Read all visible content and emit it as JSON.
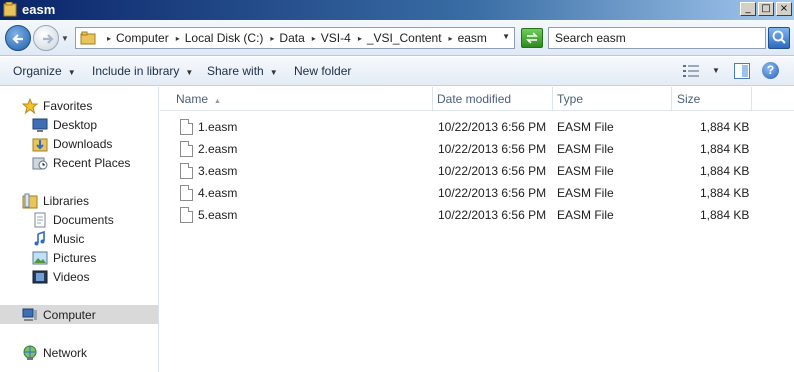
{
  "window": {
    "title": "easm",
    "controls": {
      "minimize": "_",
      "maximize": "□",
      "close": "×"
    }
  },
  "address": {
    "breadcrumbs": [
      "Computer",
      "Local Disk (C:)",
      "Data",
      "VSI-4",
      "_VSI_Content",
      "easm"
    ],
    "search_placeholder": "Search easm"
  },
  "toolbar": {
    "organize": "Organize",
    "include_in_library": "Include in library",
    "share_with": "Share with",
    "new_folder": "New folder",
    "help": "?"
  },
  "navigation": {
    "favorites": {
      "label": "Favorites",
      "items": [
        "Desktop",
        "Downloads",
        "Recent Places"
      ]
    },
    "libraries": {
      "label": "Libraries",
      "items": [
        "Documents",
        "Music",
        "Pictures",
        "Videos"
      ]
    },
    "computer": "Computer",
    "network": "Network"
  },
  "columns": {
    "name": "Name",
    "date_modified": "Date modified",
    "type": "Type",
    "size": "Size"
  },
  "files": [
    {
      "name": "1.easm",
      "date_modified": "10/22/2013 6:56 PM",
      "type": "EASM File",
      "size": "1,884 KB"
    },
    {
      "name": "2.easm",
      "date_modified": "10/22/2013 6:56 PM",
      "type": "EASM File",
      "size": "1,884 KB"
    },
    {
      "name": "3.easm",
      "date_modified": "10/22/2013 6:56 PM",
      "type": "EASM File",
      "size": "1,884 KB"
    },
    {
      "name": "4.easm",
      "date_modified": "10/22/2013 6:56 PM",
      "type": "EASM File",
      "size": "1,884 KB"
    },
    {
      "name": "5.easm",
      "date_modified": "10/22/2013 6:56 PM",
      "type": "EASM File",
      "size": "1,884 KB"
    }
  ],
  "colors": {
    "titlebar_start": "#0a246a",
    "titlebar_end": "#a6caf0",
    "selection": "#d9d9d9"
  }
}
